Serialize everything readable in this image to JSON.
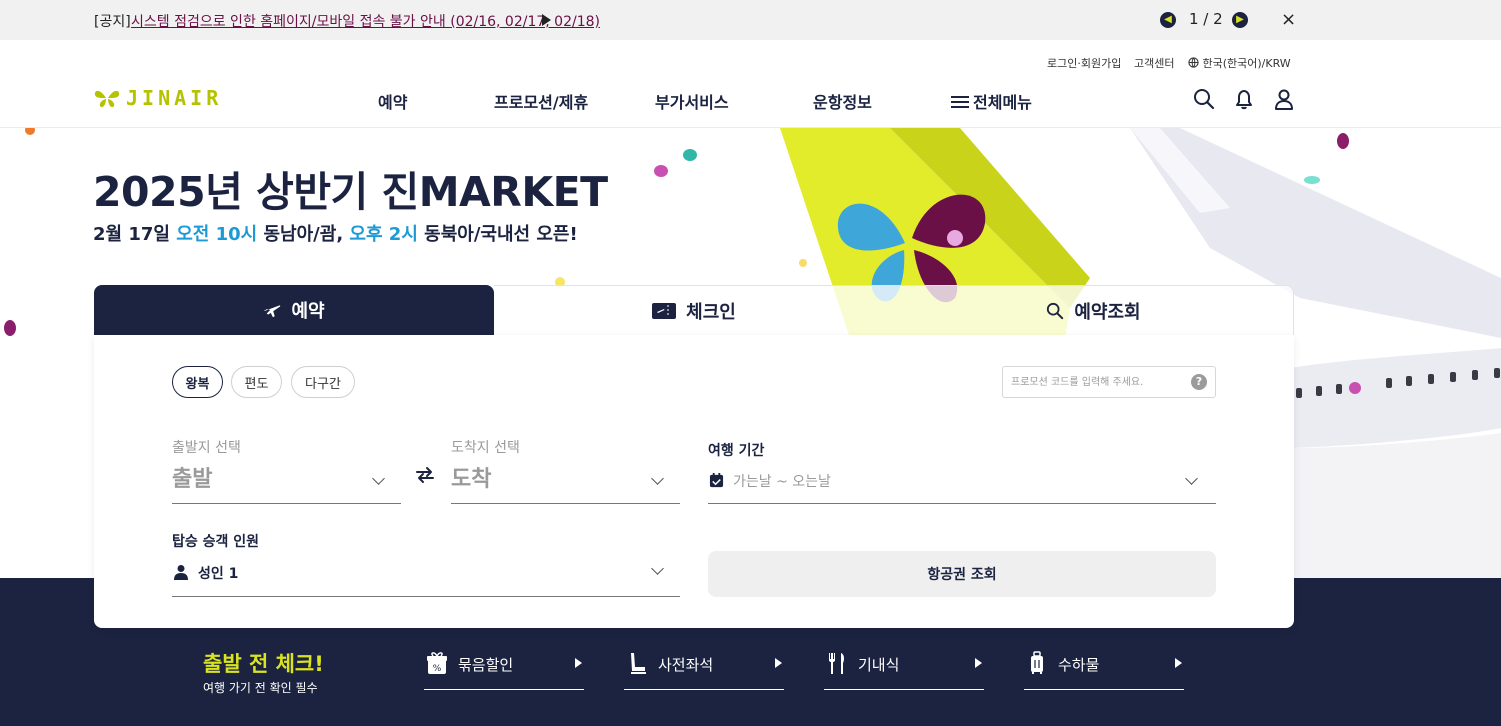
{
  "notice": {
    "tag": "[공지]",
    "message": "시스템 점검으로 인한 홈페이지/모바일 접속 불가 안내 (02/16, 02/17, 02/18)",
    "pager": "1 / 2",
    "close": "×"
  },
  "header": {
    "util": {
      "login": "로그인·회원가입",
      "customer_center": "고객센터",
      "language": "한국(한국어)/KRW"
    },
    "logo_text": "JINAIR",
    "nav": [
      "예약",
      "프로모션/제휴",
      "부가서비스",
      "운항정보",
      "전체메뉴"
    ]
  },
  "hero": {
    "title": "2025년 상반기 진MARKET",
    "sub_prefix": "2월 17일 ",
    "sub_hl1": "오전 10시",
    "sub_mid": " 동남아/괌, ",
    "sub_hl2": "오후 2시",
    "sub_suffix": " 동북아/국내선 오픈!"
  },
  "booking": {
    "tabs": [
      "예약",
      "체크인",
      "예약조회"
    ],
    "trip_types": [
      "왕복",
      "편도",
      "다구간"
    ],
    "promo_placeholder": "프로모션 코드를 입력해 주세요.",
    "promo_help": "?",
    "departure": {
      "label": "출발지 선택",
      "value": "출발"
    },
    "arrival": {
      "label": "도착지 선택",
      "value": "도착"
    },
    "period": {
      "label": "여행 기간",
      "value": "가는날 ~ 오는날"
    },
    "passengers": {
      "label": "탑승 승객 인원",
      "value": "성인 1"
    },
    "search_button": "항공권 조회"
  },
  "checklist": {
    "title": "출발 전 체크!",
    "subtitle": "여행 가기 전 확인 필수",
    "items": [
      "묶음할인",
      "사전좌석",
      "기내식",
      "수하물"
    ]
  },
  "colors": {
    "navy": "#1b2340",
    "lime": "#d9e321",
    "highlight_blue": "#1b9ad6",
    "notice_link": "#6a1046"
  }
}
